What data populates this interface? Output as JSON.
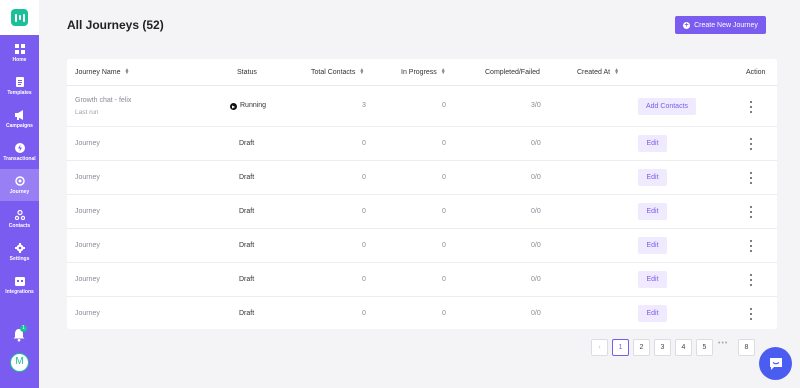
{
  "sidebar": {
    "items": [
      {
        "label": "Home",
        "icon": "grid-icon"
      },
      {
        "label": "Templates",
        "icon": "document-icon"
      },
      {
        "label": "Campaigns",
        "icon": "megaphone-icon"
      },
      {
        "label": "Transactional",
        "icon": "lightning-icon"
      },
      {
        "label": "Journey",
        "icon": "journey-icon",
        "active": true
      },
      {
        "label": "Contacts",
        "icon": "contacts-icon"
      },
      {
        "label": "Settings",
        "icon": "gear-icon"
      },
      {
        "label": "Integrations",
        "icon": "integrations-icon"
      }
    ],
    "notification_count": "1",
    "avatar_initial": "M"
  },
  "header": {
    "title": "All Journeys (52)",
    "create_button": "Create New Journey"
  },
  "table": {
    "columns": [
      "Journey Name",
      "Status",
      "Total Contacts",
      "In Progress",
      "Completed/Failed",
      "Created At",
      "Action"
    ],
    "rows": [
      {
        "name": "Growth chat - felix",
        "sub": "Last run",
        "status": "Running",
        "total": "3",
        "in_progress": "0",
        "completed": "3/0",
        "created": "",
        "action": "Add Contacts"
      },
      {
        "name": "Journey",
        "sub": "",
        "status": "Draft",
        "total": "0",
        "in_progress": "0",
        "completed": "0/0",
        "created": "",
        "action": "Edit"
      },
      {
        "name": "Journey",
        "sub": "",
        "status": "Draft",
        "total": "0",
        "in_progress": "0",
        "completed": "0/0",
        "created": "",
        "action": "Edit"
      },
      {
        "name": "Journey",
        "sub": "",
        "status": "Draft",
        "total": "0",
        "in_progress": "0",
        "completed": "0/0",
        "created": "",
        "action": "Edit"
      },
      {
        "name": "Journey",
        "sub": "",
        "status": "Draft",
        "total": "0",
        "in_progress": "0",
        "completed": "0/0",
        "created": "",
        "action": "Edit"
      },
      {
        "name": "Journey",
        "sub": "",
        "status": "Draft",
        "total": "0",
        "in_progress": "0",
        "completed": "0/0",
        "created": "",
        "action": "Edit"
      },
      {
        "name": "Journey",
        "sub": "",
        "status": "Draft",
        "total": "0",
        "in_progress": "0",
        "completed": "0/0",
        "created": "",
        "action": "Edit"
      }
    ]
  },
  "pagination": {
    "prev": "‹",
    "pages": [
      "1",
      "2",
      "3",
      "4",
      "5"
    ],
    "ellipsis": "•••",
    "last": "8",
    "next": "›",
    "current": "1"
  },
  "colors": {
    "accent": "#7b5cf0",
    "brand": "#1bbf9a",
    "chat": "#4a5df0"
  }
}
